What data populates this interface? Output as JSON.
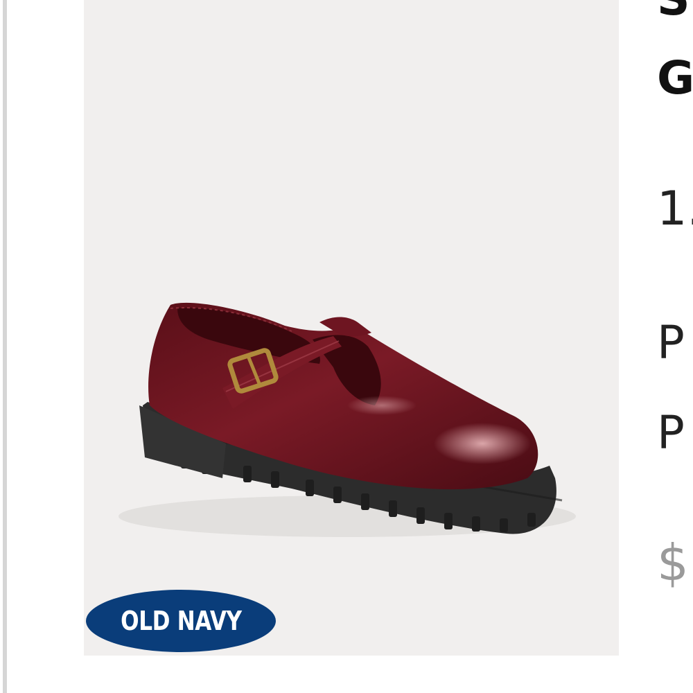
{
  "brand": {
    "logo_text": "OLD NAVY",
    "logo_color": "#0a3d7a"
  },
  "product": {
    "image_alt": "burgundy patent T-strap mary jane shoe",
    "title_line_1": "S",
    "title_line_2": "G",
    "rating_partial": "1.",
    "detail_line_1": "P",
    "detail_line_2": "P",
    "price_partial": "$"
  },
  "colors": {
    "image_bg": "#f1efee",
    "shoe_upper": "#6b1420",
    "sole": "#2a2a2a",
    "price_gray": "#9a9a9a"
  }
}
